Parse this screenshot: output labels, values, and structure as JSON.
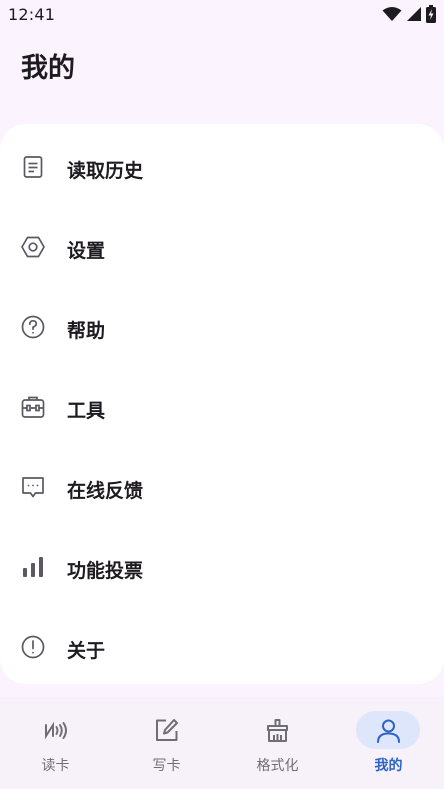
{
  "status_bar": {
    "time": "12:41",
    "icons": [
      "wifi-icon",
      "cellular-signal-icon",
      "battery-charging-icon"
    ]
  },
  "header": {
    "title": "我的"
  },
  "menu": {
    "items": [
      {
        "label": "读取历史",
        "icon": "document-icon"
      },
      {
        "label": "设置",
        "icon": "settings-icon"
      },
      {
        "label": "帮助",
        "icon": "help-icon"
      },
      {
        "label": "工具",
        "icon": "toolbox-icon"
      },
      {
        "label": "在线反馈",
        "icon": "feedback-icon"
      },
      {
        "label": "功能投票",
        "icon": "bar-chart-icon"
      },
      {
        "label": "关于",
        "icon": "info-icon"
      }
    ]
  },
  "bottom_nav": {
    "active": "我的",
    "items": [
      {
        "label": "读卡",
        "icon": "nfc-icon"
      },
      {
        "label": "写卡",
        "icon": "edit-icon"
      },
      {
        "label": "格式化",
        "icon": "brush-icon"
      },
      {
        "label": "我的",
        "icon": "person-icon"
      }
    ]
  },
  "colors": {
    "background": "#fbf3fd",
    "card": "#ffffff",
    "accent": "#2f63c8",
    "active_pill": "#dde6fb",
    "text": "#1d1b20",
    "muted": "#6f6d75"
  }
}
